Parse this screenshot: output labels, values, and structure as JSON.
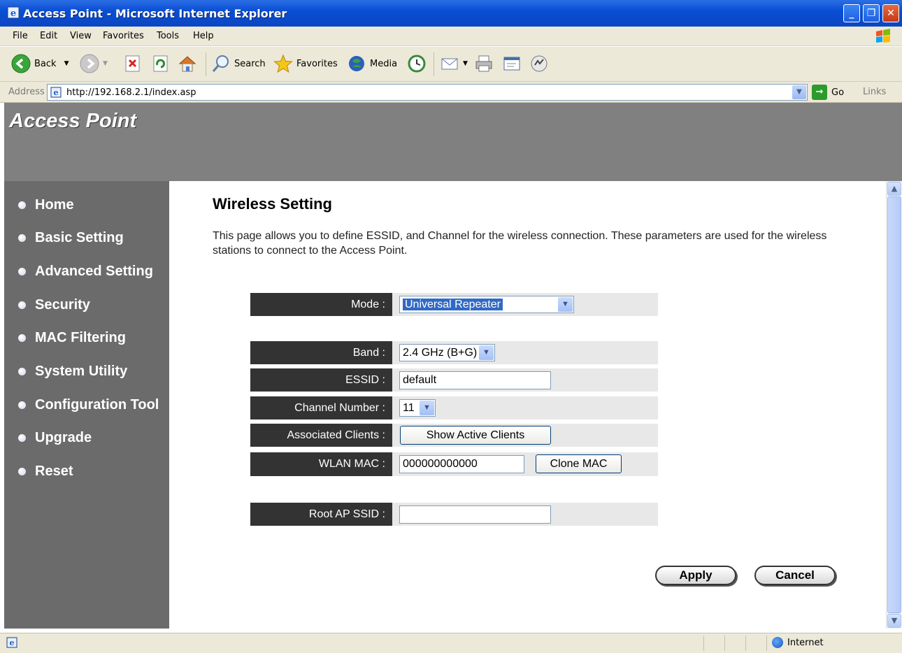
{
  "window": {
    "title": "Access Point - Microsoft Internet Explorer",
    "min_symbol": "_",
    "max_symbol": "❐",
    "close_symbol": "✕"
  },
  "menu": [
    "File",
    "Edit",
    "View",
    "Favorites",
    "Tools",
    "Help"
  ],
  "toolbar": {
    "back_label": "Back",
    "search_label": "Search",
    "favorites_label": "Favorites",
    "media_label": "Media"
  },
  "address": {
    "label": "Address",
    "url": "http://192.168.2.1/index.asp",
    "go_label": "Go",
    "links_label": "Links"
  },
  "page": {
    "header_title": "Access Point"
  },
  "nav": [
    "Home",
    "Basic Setting",
    "Advanced Setting",
    "Security",
    "MAC Filtering",
    "System Utility",
    "Configuration Tool",
    "Upgrade",
    "Reset"
  ],
  "content": {
    "heading": "Wireless Setting",
    "description": "This page allows you to define ESSID, and Channel for the wireless connection. These parameters are used for the wireless stations to connect to the Access Point.",
    "mode_label": "Mode :",
    "mode_value": "Universal Repeater",
    "band_label": "Band :",
    "band_value": "2.4 GHz (B+G)",
    "essid_label": "ESSID :",
    "essid_value": "default",
    "channel_label": "Channel Number :",
    "channel_value": "11",
    "clients_label": "Associated Clients :",
    "clients_button": "Show Active Clients",
    "wlan_mac_label": "WLAN MAC :",
    "wlan_mac_value": "000000000000",
    "clone_mac_button": "Clone MAC",
    "root_ap_label": "Root AP SSID :",
    "root_ap_value": "",
    "apply_button": "Apply",
    "cancel_button": "Cancel"
  },
  "status": {
    "zone": "Internet"
  }
}
